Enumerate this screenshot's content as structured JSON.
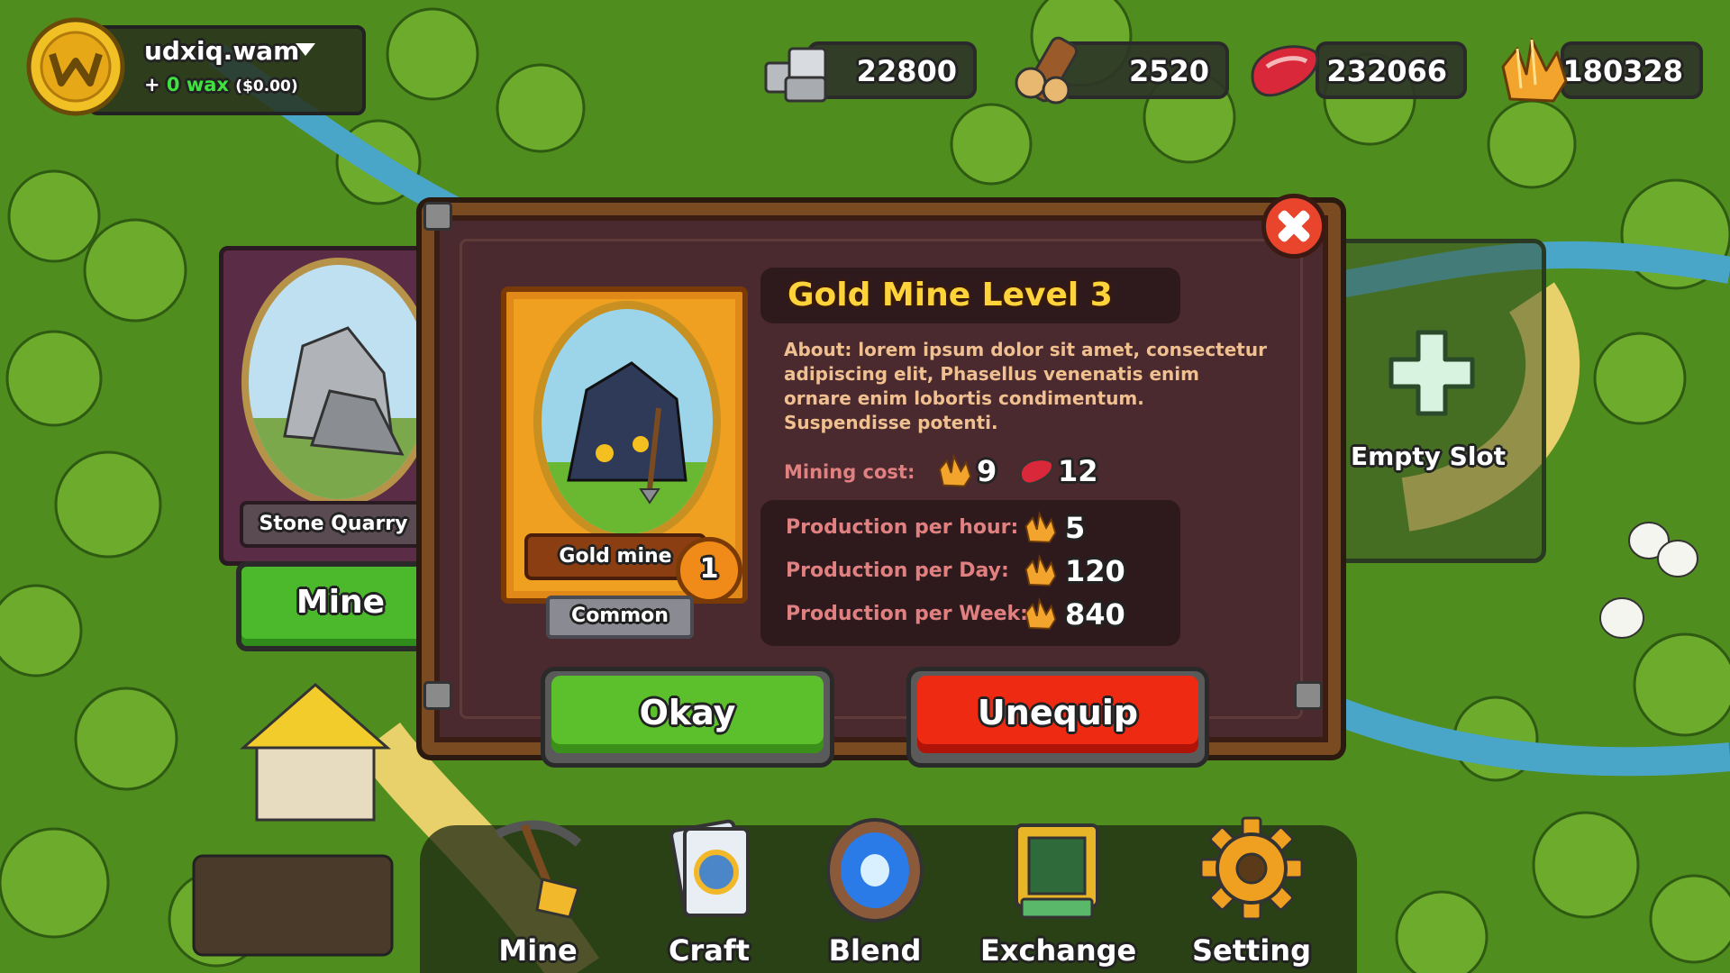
{
  "account": {
    "wallet_name": "udxiq.wam",
    "balance_prefix": "+",
    "balance_amount": "0",
    "balance_currency": "wax",
    "balance_usd": "($0.00)",
    "coin_icon": "wax-coin-icon"
  },
  "resources": [
    {
      "icon": "stone-icon",
      "value": "22800"
    },
    {
      "icon": "wood-icon",
      "value": "2520"
    },
    {
      "icon": "meat-icon",
      "value": "232066"
    },
    {
      "icon": "gold-crystal-icon",
      "value": "180328"
    }
  ],
  "left_card": {
    "label": "Stone Quarry",
    "action": "Mine"
  },
  "empty_slot": {
    "label": "Empty Slot"
  },
  "modal": {
    "title": "Gold Mine Level 3",
    "about": "About: lorem ipsum dolor sit amet, consectetur adipiscing elit, Phasellus venenatis enim ornare enim lobortis condimentum. Suspendisse potenti.",
    "card_name": "Gold mine",
    "card_level": "1",
    "rarity": "Common",
    "mining_cost_label": "Mining cost:",
    "mining_cost": [
      {
        "icon": "gold-crystal-icon",
        "value": "9"
      },
      {
        "icon": "meat-icon",
        "value": "12"
      }
    ],
    "production": [
      {
        "label": "Production per hour:",
        "value": "5",
        "icon": "gold-crystal-icon"
      },
      {
        "label": "Production per Day:",
        "value": "120",
        "icon": "gold-crystal-icon"
      },
      {
        "label": "Production per Week:",
        "value": "840",
        "icon": "gold-crystal-icon"
      }
    ],
    "okay_label": "Okay",
    "unequip_label": "Unequip"
  },
  "nav": [
    {
      "label": "Mine",
      "icon": "pickaxe-icon"
    },
    {
      "label": "Craft",
      "icon": "craft-cards-icon"
    },
    {
      "label": "Blend",
      "icon": "portal-icon"
    },
    {
      "label": "Exchange",
      "icon": "safe-icon"
    },
    {
      "label": "Setting",
      "icon": "gear-icon"
    }
  ],
  "colors": {
    "accent_yellow": "#ffd43a",
    "okay_green": "#5cc02c",
    "unequip_red": "#ee2a12",
    "label_pink": "#e08080"
  }
}
